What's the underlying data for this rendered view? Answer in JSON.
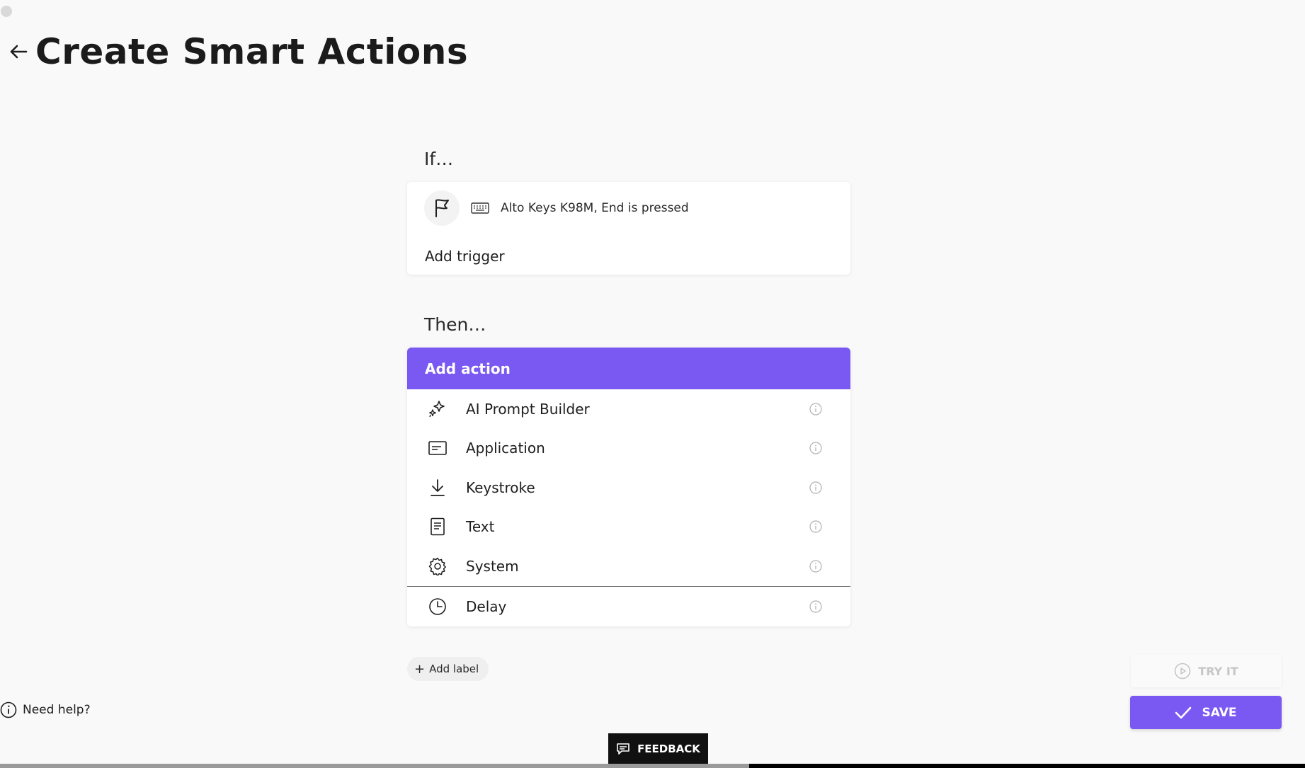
{
  "header": {
    "title": "Create Smart Actions",
    "back_icon": "arrow-left-icon"
  },
  "if_section": {
    "label": "If…",
    "trigger": {
      "icon": "flag-icon",
      "device_icon": "keyboard-icon",
      "text": "Alto Keys K98M, End is pressed"
    },
    "add_trigger_label": "Add trigger"
  },
  "then_section": {
    "label": "Then…",
    "add_action_label": "Add action",
    "actions": [
      {
        "label": "AI Prompt Builder",
        "icon": "sparkle-icon"
      },
      {
        "label": "Application",
        "icon": "application-window-icon"
      },
      {
        "label": "Keystroke",
        "icon": "download-arrow-icon"
      },
      {
        "label": "Text",
        "icon": "document-text-icon"
      },
      {
        "label": "System",
        "icon": "gear-icon"
      },
      {
        "label": "Delay",
        "icon": "clock-icon"
      }
    ]
  },
  "add_label_button": "Add label",
  "help": {
    "label": "Need help?",
    "icon": "info-icon"
  },
  "buttons": {
    "try_it": "TRY IT",
    "save": "SAVE",
    "feedback": "FEEDBACK"
  },
  "colors": {
    "accent": "#7a58f2",
    "background": "#f9f9f9",
    "feedback_bg": "#111111"
  }
}
